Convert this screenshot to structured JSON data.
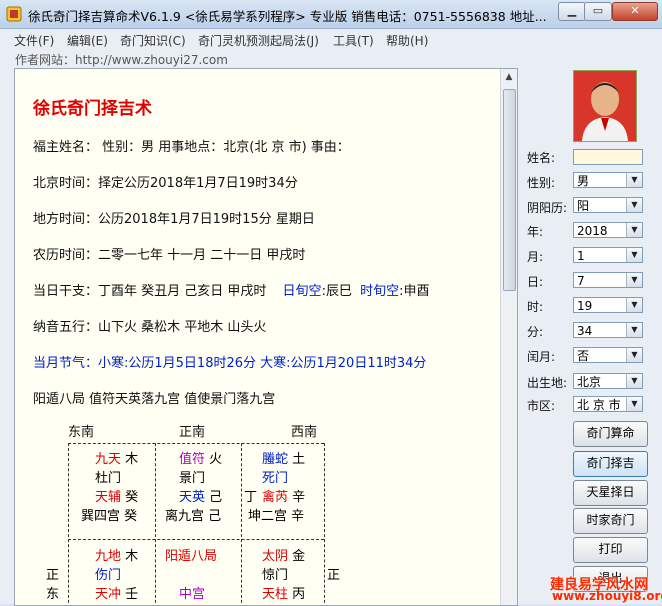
{
  "window": {
    "title": "徐氏奇门择吉算命术V6.1.9 <徐氏易学系列程序> 专业版    销售电话：0751-5556838    地址..."
  },
  "menu": [
    "文件(F)",
    "编辑(E)",
    "奇门知识(C)",
    "奇门灵机预测起局法(J)",
    "工具(T)",
    "帮助(H)"
  ],
  "site": "作者网站：http://www.zhouyi27.com",
  "doc": {
    "title": "徐氏奇门择吉术",
    "l1": "福主姓名：  性别：男    用事地点：北京(北 京 市)   事由：",
    "l2": "北京时间：择定公历2018年1月7日19时34分",
    "l3": "地方时间：公历2018年1月7日19时15分  星期日",
    "l4": "农历时间：二零一七年  十一月  二十一日  甲戌时",
    "l5a": "当日干支：丁酉年  癸丑月  己亥日  甲戌时",
    "l5b_label1": "日旬空",
    "l5b_val1": ":辰巳",
    "l5b_label2": "时旬空",
    "l5b_val2": ":申酉",
    "l6": "纳音五行：山下火  桑松木  平地木  山头火",
    "l7": "当月节气：小寒:公历1月5日18时26分  大寒:公历1月20日11时34分",
    "l8": "阳遁八局  值符天英落九宫  值使景门落九宫"
  },
  "chart": {
    "dir_se": "东南",
    "dir_s": "正南",
    "dir_sw": "西南",
    "side_e1": "正",
    "side_e2": "东",
    "side_w1": "正",
    "c1": {
      "a": "九天",
      "a2": "木",
      "b": "杜门",
      "c": "天辅",
      "c2": "癸",
      "d": "巽四宫",
      "d2": "癸"
    },
    "c2": {
      "a": "值符",
      "a2": "火",
      "b": "景门",
      "c": "天英",
      "c2": "己",
      "d": "离九宫",
      "d2": "己",
      "e": "丁"
    },
    "c3": {
      "a": "螣蛇",
      "a2": "土",
      "b": "死门",
      "c": "禽芮",
      "c2": "辛",
      "d": "坤二宫",
      "d2": "辛"
    },
    "c4": {
      "a": "九地",
      "a2": "木",
      "b": "伤门",
      "c": "天冲",
      "c2": "壬"
    },
    "c5": {
      "a": "阳遁八局",
      "b": "中宫"
    },
    "c6": {
      "a": "太阴",
      "a2": "金",
      "b": "惊门",
      "c": "天柱",
      "c2": "丙"
    }
  },
  "form": {
    "name_label": "姓名:",
    "name_value": "",
    "sex_label": "性别:",
    "sex_value": "男",
    "calendar_label": "阴阳历:",
    "calendar_value": "阳",
    "year_label": "年:",
    "year_value": "2018",
    "month_label": "月:",
    "month_value": "1",
    "day_label": "日:",
    "day_value": "7",
    "hour_label": "时:",
    "hour_value": "19",
    "minute_label": "分:",
    "minute_value": "34",
    "leap_label": "闰月:",
    "leap_value": "否",
    "birthplace_label": "出生地:",
    "birthplace_value": "北京",
    "district_label": "市区:",
    "district_value": "北 京 市"
  },
  "buttons": [
    "奇门算命",
    "奇门择吉",
    "天星择日",
    "时家奇门",
    "打印",
    "退出"
  ],
  "watermark": {
    "line1": "建良易学风水网",
    "line2": "www.zhouyi8.org"
  }
}
